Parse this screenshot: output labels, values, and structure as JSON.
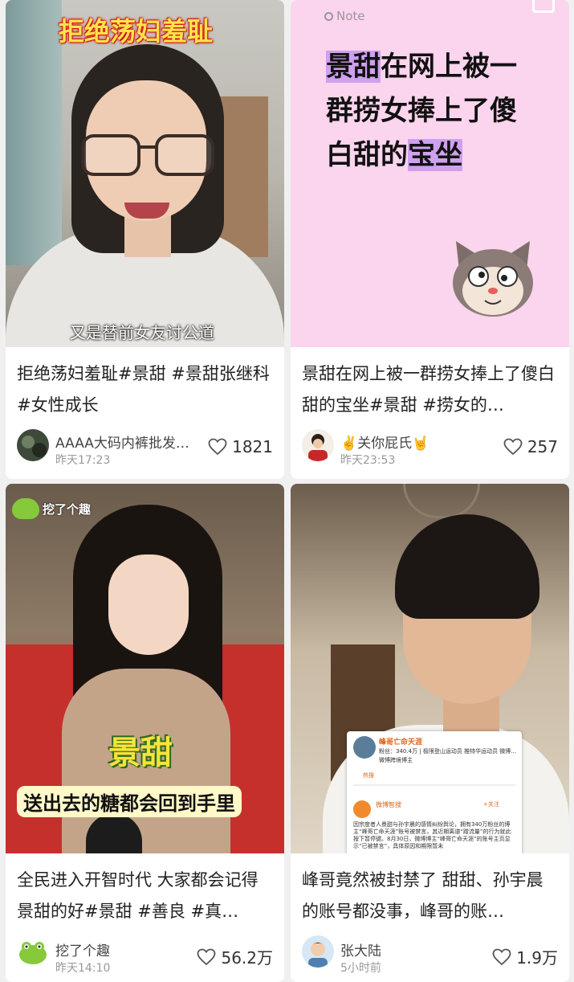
{
  "cards": [
    {
      "cover": {
        "headline": "拒绝荡妇羞耻",
        "subtitle": "又是替前女友讨公道"
      },
      "title": "拒绝荡妇羞耻#景甜 #景甜张继科 #女性成长",
      "author": "AAAA大码内裤批发…",
      "time": "昨天17:23",
      "likes": "1821"
    },
    {
      "cover": {
        "note_label": "Note",
        "text_before": "在网上被一群捞女捧上了傻白甜的",
        "hl_start": "景甜",
        "hl_end_1": "宝",
        "hl_end_2": "坐"
      },
      "title": "景甜在网上被一群捞女捧上了傻白甜的宝坐#景甜 #捞女的…",
      "author": "✌️关你屁氏🤘",
      "time": "昨天23:53",
      "likes": "257"
    },
    {
      "cover": {
        "badge": "挖了个趣",
        "name": "景甜",
        "caption": "送出去的糖都会回到手里"
      },
      "title": "全民进入开智时代 大家都会记得景甜的好#景甜 #善良 #真…",
      "author": "挖了个趣",
      "time": "昨天14:10",
      "likes": "56.2万"
    },
    {
      "cover": {
        "screen_name": "峰哥亡命天涯",
        "screen_fans": "粉丝：340.4万 | 极限登山运动员 推特华运动员 微博…",
        "screen_verified": "微博跨境博主",
        "screen_hot": "热搜",
        "screen_poster": "微博智搜",
        "screen_follow": "+关注",
        "screen_body": "因宗度者人景甜与孙宇晨的感情纠纷舆论，拥有340万粉丝的博主“峰哥亡命天涯”账号被禁言，其近期离谱“蹭流量”的行为就此按下暂停键。8月30日，微博博主“峰哥亡命天涯”的账号主页显示“已被禁言”，具体原因和期限暂未"
      },
      "title": "峰哥竟然被封禁了 甜甜、孙宇晨的账号都没事，峰哥的账…",
      "author": "张大陆",
      "time": "5小时前",
      "likes": "1.9万"
    }
  ],
  "colors": {
    "background": "#f0f0f0",
    "highlight": "#cfa0ef",
    "headline": "#ffe34a"
  },
  "icons": [
    "heart-icon",
    "note-icon",
    "frog-icon"
  ]
}
